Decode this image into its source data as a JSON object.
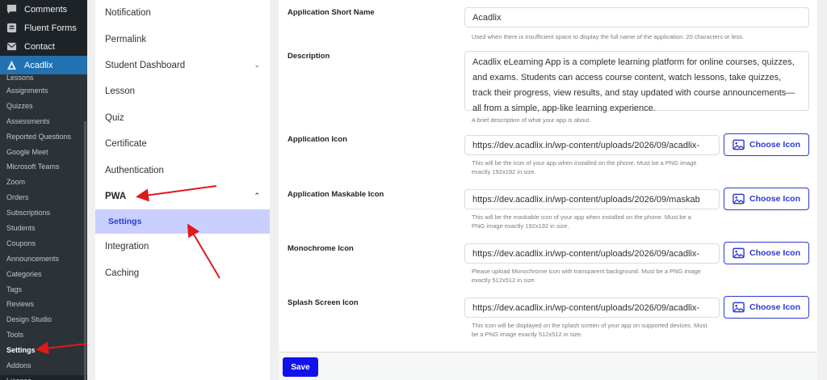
{
  "wp_menu": {
    "top_items": [
      {
        "label": "Comments",
        "icon": "comment-icon"
      },
      {
        "label": "Fluent Forms",
        "icon": "forms-icon"
      },
      {
        "label": "Contact",
        "icon": "mail-icon"
      }
    ],
    "active_item": {
      "label": "Acadlix",
      "icon": "acadlix-logo-icon"
    },
    "sub_items": [
      "Lessons",
      "Assignments",
      "Quizzes",
      "Assessments",
      "Reported Questions",
      "Google Meet",
      "Microsoft Teams",
      "Zoom",
      "Orders",
      "Subscriptions",
      "Students",
      "Coupons",
      "Announcements",
      "Categories",
      "Tags",
      "Reviews",
      "Design Studio",
      "Tools",
      "Settings",
      "Addons",
      "License"
    ],
    "current_sub": "Settings"
  },
  "settings_nav": {
    "items": [
      "Notification",
      "Permalink",
      "Student Dashboard",
      "Lesson",
      "Quiz",
      "Certificate",
      "Authentication"
    ],
    "pwa_label": "PWA",
    "pwa_sub": "Settings",
    "after_items": [
      "Integration",
      "Caching"
    ]
  },
  "form": {
    "short_name": {
      "label": "Application Short Name",
      "value": "Acadlix",
      "help": "Used when there is insufficient space to display the full name of the application. 20 characters or less."
    },
    "description": {
      "label": "Description",
      "value": "Acadlix eLearning App is a complete learning platform for online courses, quizzes, and exams. Students can access course content, watch lessons, take quizzes, track their progress, view results, and stay updated with course announcements—all from a simple, app-like learning experience.",
      "help": "A brief description of what your app is about."
    },
    "app_icon": {
      "label": "Application Icon",
      "value": "https://dev.acadlix.in/wp-content/uploads/2026/09/acadlix-",
      "help": "This will be the icon of your app when installed on the phone. Must be a PNG image exactly 192x192 in size."
    },
    "maskable_icon": {
      "label": "Application Maskable Icon",
      "value": "https://dev.acadlix.in/wp-content/uploads/2026/09/maskab",
      "help": "This will be the maskable icon of your app when installed on the phone. Must be a PNG image exactly 192x192 in size."
    },
    "monochrome_icon": {
      "label": "Monochrome Icon",
      "value": "https://dev.acadlix.in/wp-content/uploads/2026/09/acadlix-",
      "help": "Please upload Monochrome icon with transparent background. Must be a PNG image exactly 512x512 in size."
    },
    "splash_icon": {
      "label": "Splash Screen Icon",
      "value": "https://dev.acadlix.in/wp-content/uploads/2026/09/acadlix-",
      "help": "This icon will be displayed on the splash screen of your app on supported devices. Must be a PNG image exactly 512x512 in size."
    },
    "choose_label": "Choose Icon",
    "save_label": "Save"
  },
  "colors": {
    "accent": "#2c3bd1",
    "save": "#1111ee",
    "annotation_arrow": "#e0191d",
    "wp_sidebar": "#1d2327",
    "wp_active": "#2271b1"
  }
}
